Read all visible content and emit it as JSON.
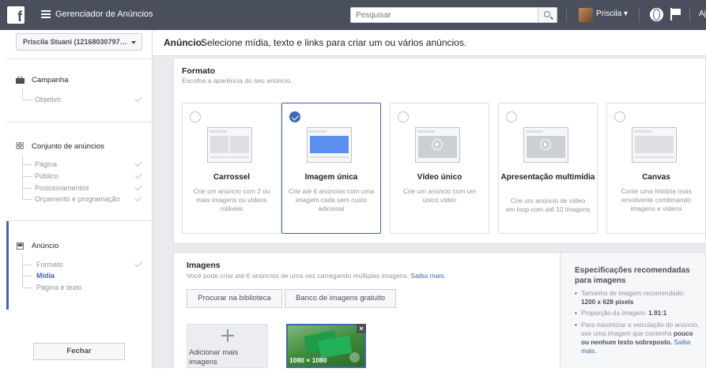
{
  "topbar": {
    "logo": "f",
    "app_title": "Gerenciador de Anúncios",
    "search_placeholder": "Pesquisar",
    "user_name": "Priscila ▾",
    "help": "Aj"
  },
  "sidebar": {
    "account": "Priscila Stuani (12168030797… ",
    "campaign": {
      "title": "Campanha",
      "items": [
        "Objetivo"
      ]
    },
    "adset": {
      "title": "Conjunto de anúncios",
      "items": [
        "Página",
        "Público",
        "Posicionamentos",
        "Orçamento e programação"
      ]
    },
    "ad": {
      "title": "Anúncio",
      "items": [
        "Formato",
        "Mídia",
        "Página e texto"
      ]
    },
    "close_label": "Fechar"
  },
  "main": {
    "header_strong": "Anúncio:",
    "header_rest": "Selecione mídia, texto e links para criar um ou vários anúncios."
  },
  "format": {
    "title": "Formato",
    "subtitle": "Escolha a aparência do seu anúncio.",
    "options": [
      {
        "name": "Carrossel",
        "desc": "Crie um anúncio com 2 ou mais imagens ou vídeos roláveis"
      },
      {
        "name": "Imagem única",
        "desc": "Crie até 6 anúncios com uma imagem cada sem custo adicional"
      },
      {
        "name": "Vídeo único",
        "desc": "Crie um anúncio com um único vídeo"
      },
      {
        "name": "Apresentação multimídia",
        "desc": "Crie um anúncio de vídeo em loop com até 10 imagens"
      },
      {
        "name": "Canvas",
        "desc": "Conte uma história mais envolvente combinando imagens e vídeos"
      }
    ],
    "selected_index": 1
  },
  "images": {
    "title": "Imagens",
    "desc": "Você pode criar até 6 anúncios de uma vez carregando múltiplas imagens.",
    "desc_link": "Saiba mais.",
    "btn_library": "Procurar na biblioteca",
    "btn_free": "Banco de imagens gratuito",
    "add_label": "Adicionar mais imagens",
    "thumb_dims": "1080 × 1080"
  },
  "specs": {
    "title": "Especificações recomendadas para imagens",
    "size_label": "Tamanho de imagem recomendado:",
    "size_value": "1200 x 628 pixels",
    "ratio_label": "Proporção da imagem:",
    "ratio_value": "1.91:1",
    "tip_text": "Para maximizar a veiculação do anúncio, use uma imagem que contenha",
    "tip_bold": "pouco ou nenhum texto sobreposto.",
    "tip_link": "Saiba mais."
  }
}
